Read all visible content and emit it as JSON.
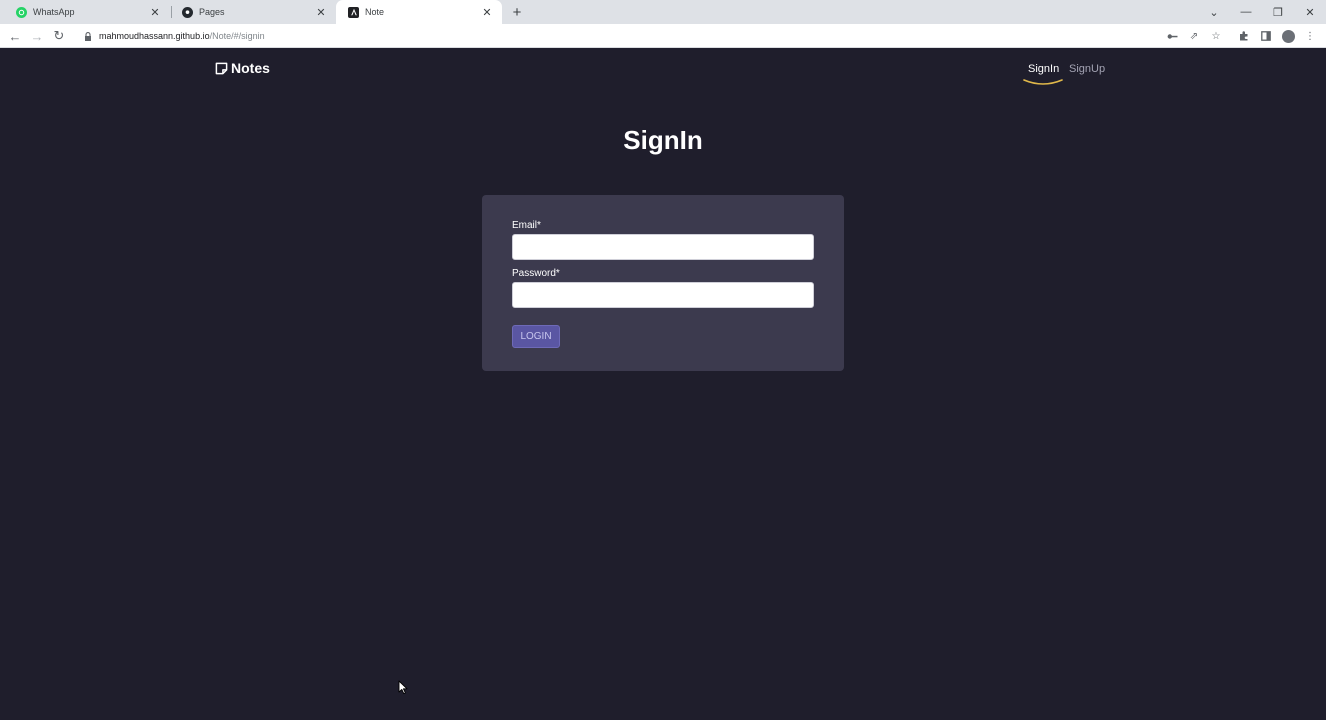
{
  "browser": {
    "tabs": [
      {
        "title": "WhatsApp",
        "icon": "whatsapp-icon",
        "active": false
      },
      {
        "title": "Pages",
        "icon": "github-icon",
        "active": false
      },
      {
        "title": "Note",
        "icon": "angular-icon",
        "active": true
      }
    ],
    "url": {
      "host": "mahmoudhassann.github.io",
      "path": "/Note/#/signin"
    }
  },
  "navbar": {
    "brand": "Notes",
    "links": [
      {
        "label": "SignIn",
        "active": true
      },
      {
        "label": "SignUp",
        "active": false
      }
    ]
  },
  "main": {
    "title": "SignIn",
    "form": {
      "email_label": "Email*",
      "email_value": "",
      "password_label": "Password*",
      "password_value": "",
      "login_label": "LOGIN"
    }
  },
  "colors": {
    "page_bg": "#1f1e2c",
    "card_bg": "#3c3a4e",
    "button_bg": "#5a56a3",
    "accent_underline": "#e0b84a"
  }
}
